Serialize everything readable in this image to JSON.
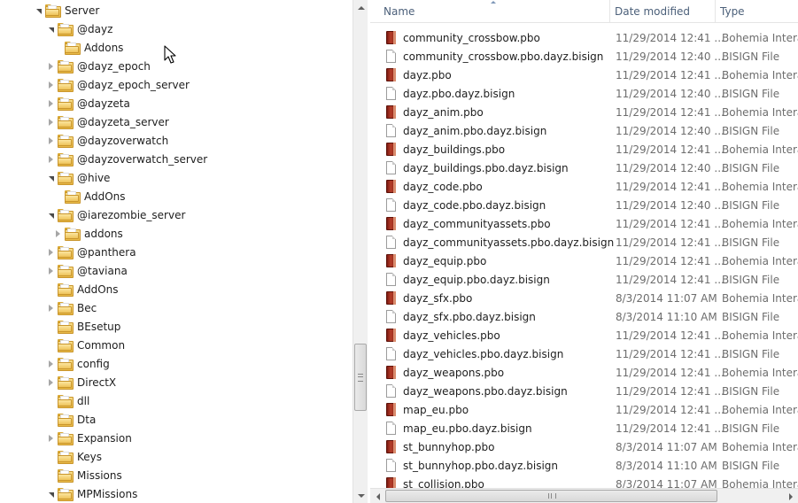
{
  "tree": {
    "items": [
      {
        "label": "Server",
        "state": "open",
        "level": 0
      },
      {
        "label": "@dayz",
        "state": "open",
        "level": 1
      },
      {
        "label": "Addons",
        "state": "none",
        "level": 2,
        "selected": true
      },
      {
        "label": "@dayz_epoch",
        "state": "closed",
        "level": 1
      },
      {
        "label": "@dayz_epoch_server",
        "state": "closed",
        "level": 1
      },
      {
        "label": "@dayzeta",
        "state": "closed",
        "level": 1
      },
      {
        "label": "@dayzeta_server",
        "state": "closed",
        "level": 1
      },
      {
        "label": "@dayzoverwatch",
        "state": "closed",
        "level": 1
      },
      {
        "label": "@dayzoverwatch_server",
        "state": "closed",
        "level": 1
      },
      {
        "label": "@hive",
        "state": "open",
        "level": 1
      },
      {
        "label": "AddOns",
        "state": "none",
        "level": 2
      },
      {
        "label": "@iarezombie_server",
        "state": "open",
        "level": 1
      },
      {
        "label": "addons",
        "state": "closed",
        "level": 2
      },
      {
        "label": "@panthera",
        "state": "closed",
        "level": 1
      },
      {
        "label": "@taviana",
        "state": "closed",
        "level": 1
      },
      {
        "label": "AddOns",
        "state": "none",
        "level": 1
      },
      {
        "label": "Bec",
        "state": "closed",
        "level": 1
      },
      {
        "label": "BEsetup",
        "state": "none",
        "level": 1
      },
      {
        "label": "Common",
        "state": "none",
        "level": 1
      },
      {
        "label": "config",
        "state": "closed",
        "level": 1
      },
      {
        "label": "DirectX",
        "state": "closed",
        "level": 1
      },
      {
        "label": "dll",
        "state": "none",
        "level": 1
      },
      {
        "label": "Dta",
        "state": "none",
        "level": 1
      },
      {
        "label": "Expansion",
        "state": "closed",
        "level": 1
      },
      {
        "label": "Keys",
        "state": "none",
        "level": 1
      },
      {
        "label": "Missions",
        "state": "none",
        "level": 1
      },
      {
        "label": "MPMissions",
        "state": "open",
        "level": 1
      }
    ]
  },
  "list": {
    "columns": {
      "name": "Name",
      "date": "Date modified",
      "type": "Type"
    },
    "files": [
      {
        "name": "community_crossbow.pbo",
        "date": "11/29/2014 12:41 ...",
        "type": "Bohemia Interac",
        "icon": "pbo"
      },
      {
        "name": "community_crossbow.pbo.dayz.bisign",
        "date": "11/29/2014 12:40 ...",
        "type": "BISIGN File",
        "icon": "doc"
      },
      {
        "name": "dayz.pbo",
        "date": "11/29/2014 12:41 ...",
        "type": "Bohemia Interac",
        "icon": "pbo"
      },
      {
        "name": "dayz.pbo.dayz.bisign",
        "date": "11/29/2014 12:40 ...",
        "type": "BISIGN File",
        "icon": "doc"
      },
      {
        "name": "dayz_anim.pbo",
        "date": "11/29/2014 12:41 ...",
        "type": "Bohemia Interac",
        "icon": "pbo"
      },
      {
        "name": "dayz_anim.pbo.dayz.bisign",
        "date": "11/29/2014 12:40 ...",
        "type": "BISIGN File",
        "icon": "doc"
      },
      {
        "name": "dayz_buildings.pbo",
        "date": "11/29/2014 12:41 ...",
        "type": "Bohemia Interac",
        "icon": "pbo"
      },
      {
        "name": "dayz_buildings.pbo.dayz.bisign",
        "date": "11/29/2014 12:40 ...",
        "type": "BISIGN File",
        "icon": "doc"
      },
      {
        "name": "dayz_code.pbo",
        "date": "11/29/2014 12:41 ...",
        "type": "Bohemia Interac",
        "icon": "pbo"
      },
      {
        "name": "dayz_code.pbo.dayz.bisign",
        "date": "11/29/2014 12:40 ...",
        "type": "BISIGN File",
        "icon": "doc"
      },
      {
        "name": "dayz_communityassets.pbo",
        "date": "11/29/2014 12:41 ...",
        "type": "Bohemia Interac",
        "icon": "pbo"
      },
      {
        "name": "dayz_communityassets.pbo.dayz.bisign",
        "date": "11/29/2014 12:41 ...",
        "type": "BISIGN File",
        "icon": "doc"
      },
      {
        "name": "dayz_equip.pbo",
        "date": "11/29/2014 12:41 ...",
        "type": "Bohemia Interac",
        "icon": "pbo"
      },
      {
        "name": "dayz_equip.pbo.dayz.bisign",
        "date": "11/29/2014 12:41 ...",
        "type": "BISIGN File",
        "icon": "doc"
      },
      {
        "name": "dayz_sfx.pbo",
        "date": "8/3/2014 11:07 AM",
        "type": "Bohemia Interac",
        "icon": "pbo"
      },
      {
        "name": "dayz_sfx.pbo.dayz.bisign",
        "date": "8/3/2014 11:10 AM",
        "type": "BISIGN File",
        "icon": "doc"
      },
      {
        "name": "dayz_vehicles.pbo",
        "date": "11/29/2014 12:41 ...",
        "type": "Bohemia Interac",
        "icon": "pbo"
      },
      {
        "name": "dayz_vehicles.pbo.dayz.bisign",
        "date": "11/29/2014 12:41 ...",
        "type": "BISIGN File",
        "icon": "doc"
      },
      {
        "name": "dayz_weapons.pbo",
        "date": "11/29/2014 12:41 ...",
        "type": "Bohemia Interac",
        "icon": "pbo"
      },
      {
        "name": "dayz_weapons.pbo.dayz.bisign",
        "date": "11/29/2014 12:41 ...",
        "type": "BISIGN File",
        "icon": "doc"
      },
      {
        "name": "map_eu.pbo",
        "date": "11/29/2014 12:41 ...",
        "type": "Bohemia Interac",
        "icon": "pbo"
      },
      {
        "name": "map_eu.pbo.dayz.bisign",
        "date": "11/29/2014 12:41 ...",
        "type": "BISIGN File",
        "icon": "doc"
      },
      {
        "name": "st_bunnyhop.pbo",
        "date": "8/3/2014 11:07 AM",
        "type": "Bohemia Interac",
        "icon": "pbo"
      },
      {
        "name": "st_bunnyhop.pbo.dayz.bisign",
        "date": "8/3/2014 11:10 AM",
        "type": "BISIGN File",
        "icon": "doc"
      },
      {
        "name": "st_collision.pbo",
        "date": "8/3/2014 11:07 AM",
        "type": "Bohemia Interac",
        "icon": "pbo"
      }
    ]
  }
}
